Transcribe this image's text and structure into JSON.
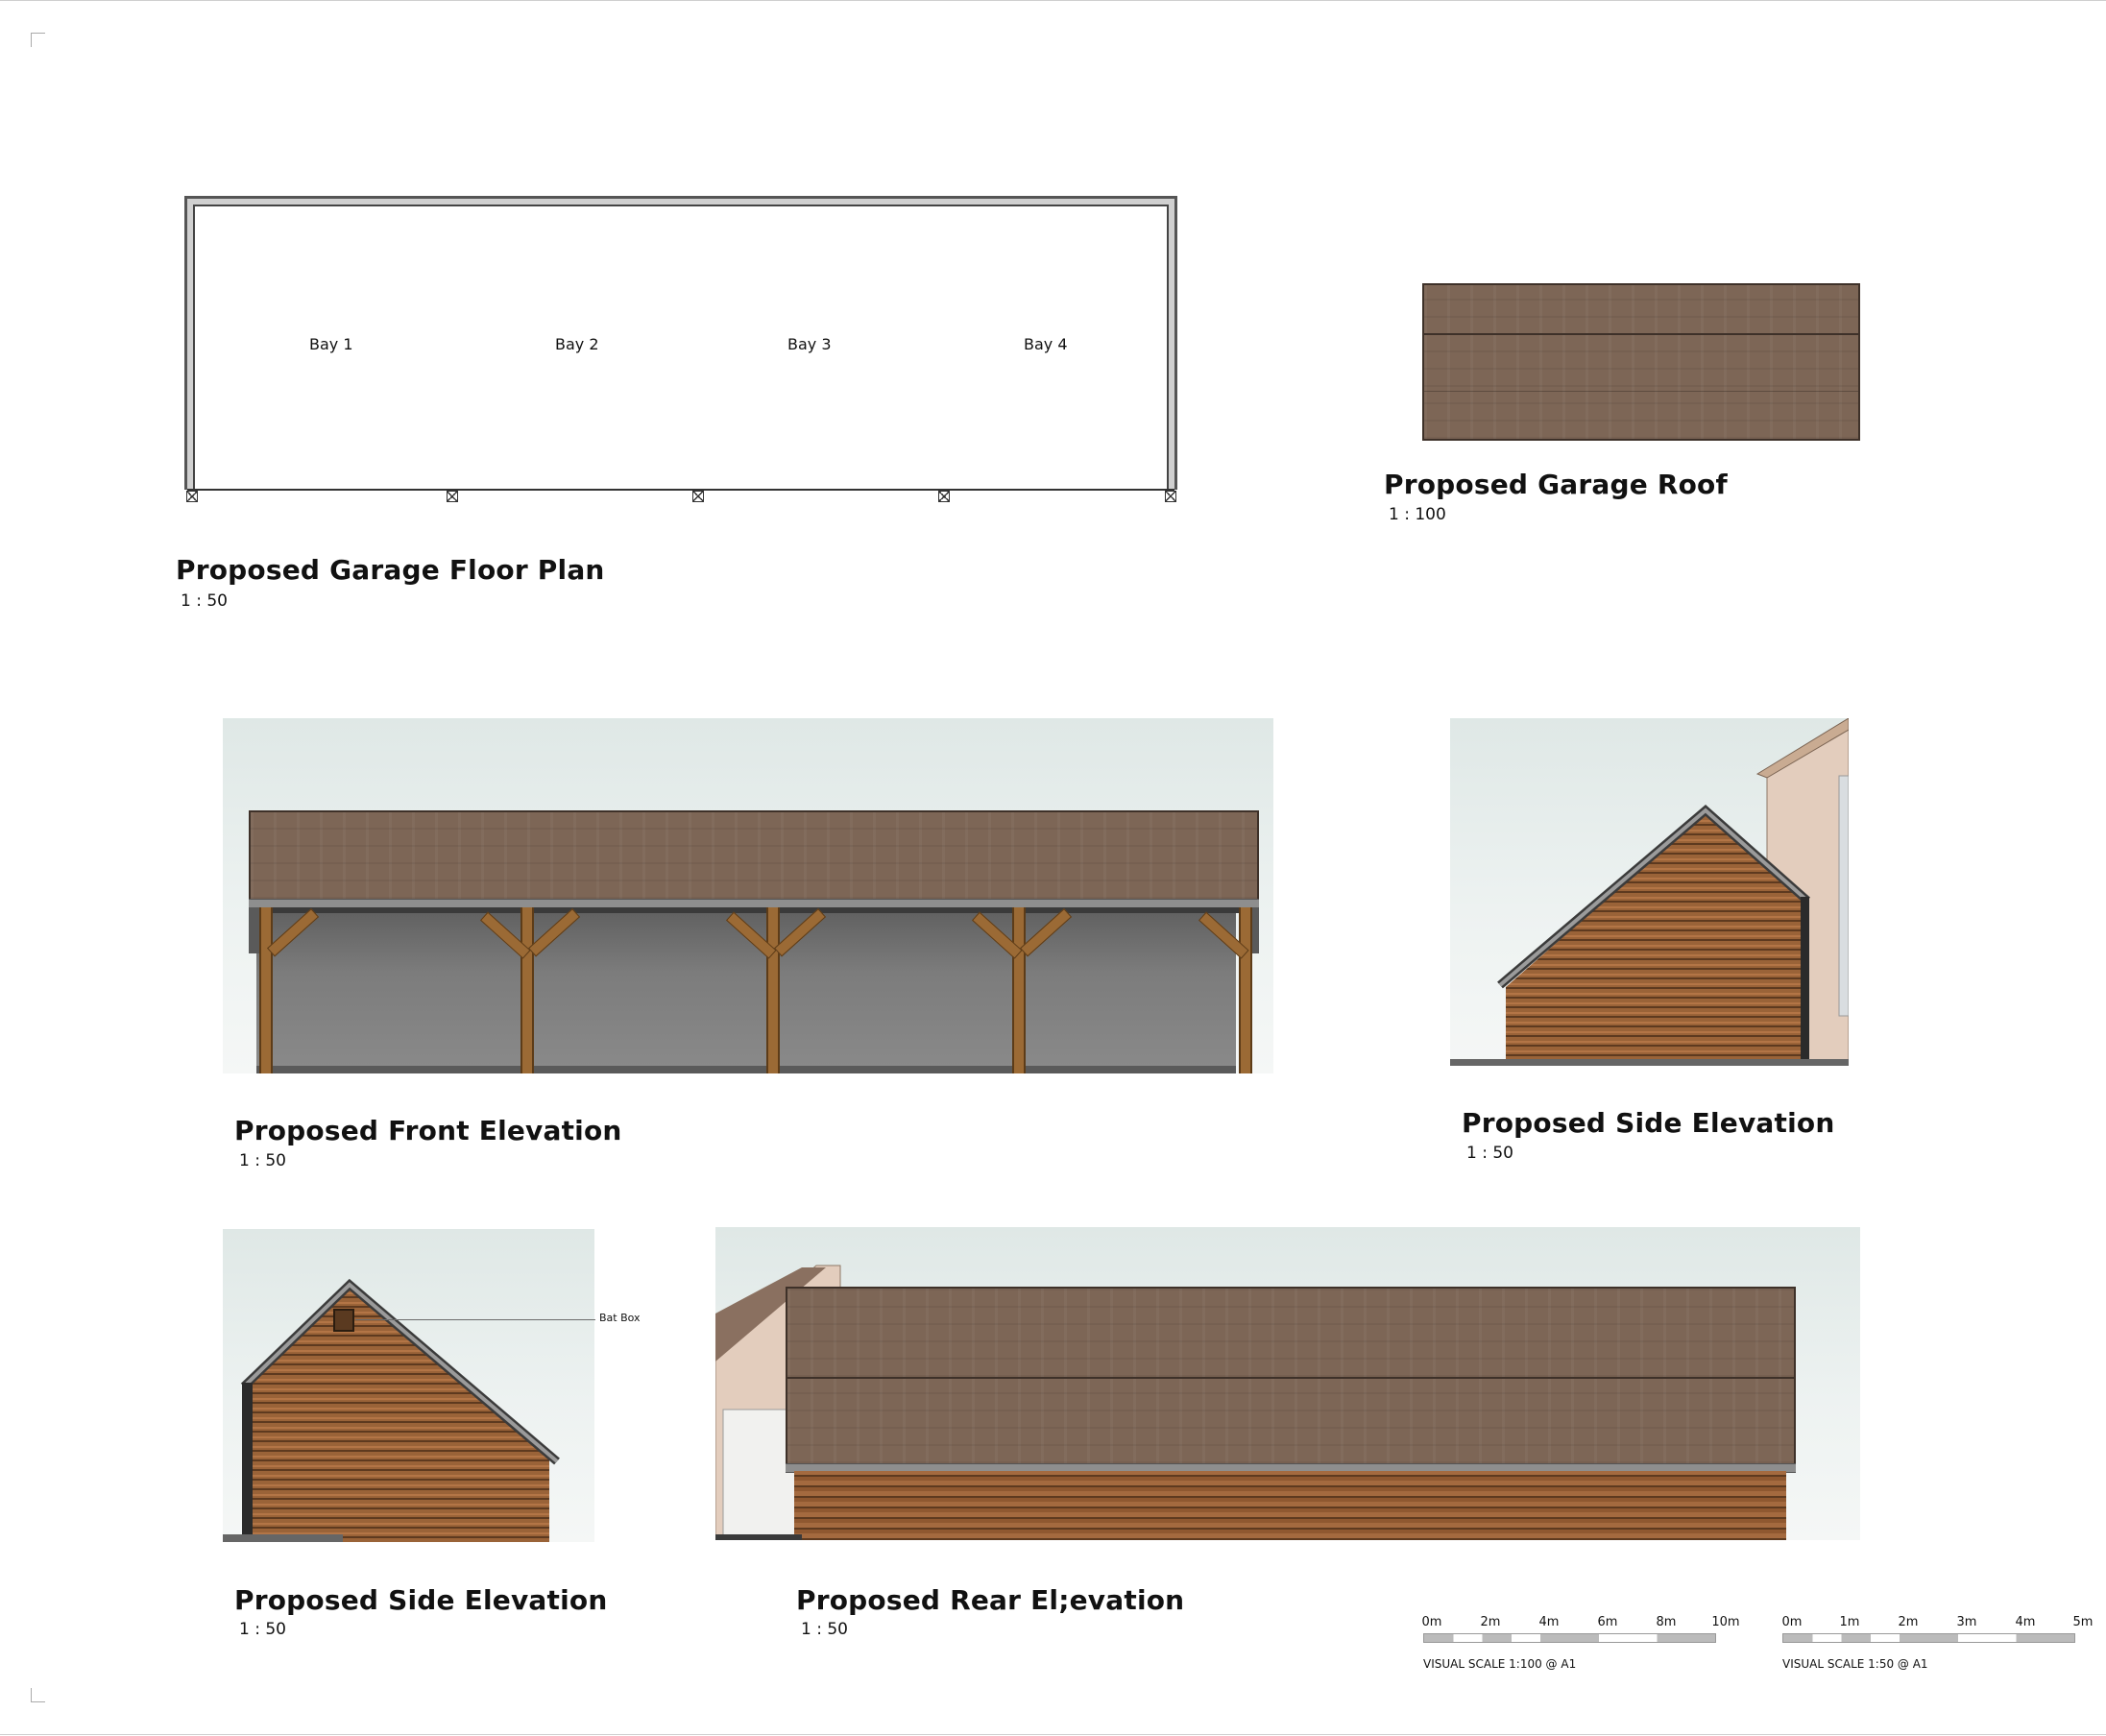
{
  "floor_plan": {
    "title": "Proposed Garage Floor Plan",
    "scale": "1 : 50",
    "bays": [
      "Bay 1",
      "Bay 2",
      "Bay 3",
      "Bay 4"
    ]
  },
  "roof_plan": {
    "title": "Proposed Garage Roof",
    "scale": "1 : 100"
  },
  "front_elevation": {
    "title": "Proposed Front Elevation",
    "scale": "1 : 50"
  },
  "side_elevation_right": {
    "title": "Proposed Side Elevation",
    "scale": "1 : 50"
  },
  "side_elevation_left": {
    "title": "Proposed Side Elevation",
    "scale": "1 : 50",
    "annotation": "Bat Box"
  },
  "rear_elevation": {
    "title": "Proposed Rear El;evation",
    "scale": "1 : 50"
  },
  "scale_bars": [
    {
      "ticks": [
        "0m",
        "2m",
        "4m",
        "6m",
        "8m",
        "10m"
      ],
      "caption": "VISUAL SCALE 1:100  @ A1"
    },
    {
      "ticks": [
        "0m",
        "1m",
        "2m",
        "3m",
        "4m",
        "5m"
      ],
      "caption": "VISUAL SCALE 1:50  @ A1"
    }
  ],
  "colors": {
    "roof_tile": "#7d6656",
    "timber_cladding": "#9a6338",
    "oak_frame": "#9b6a35",
    "sky": "#dfe8e6"
  }
}
